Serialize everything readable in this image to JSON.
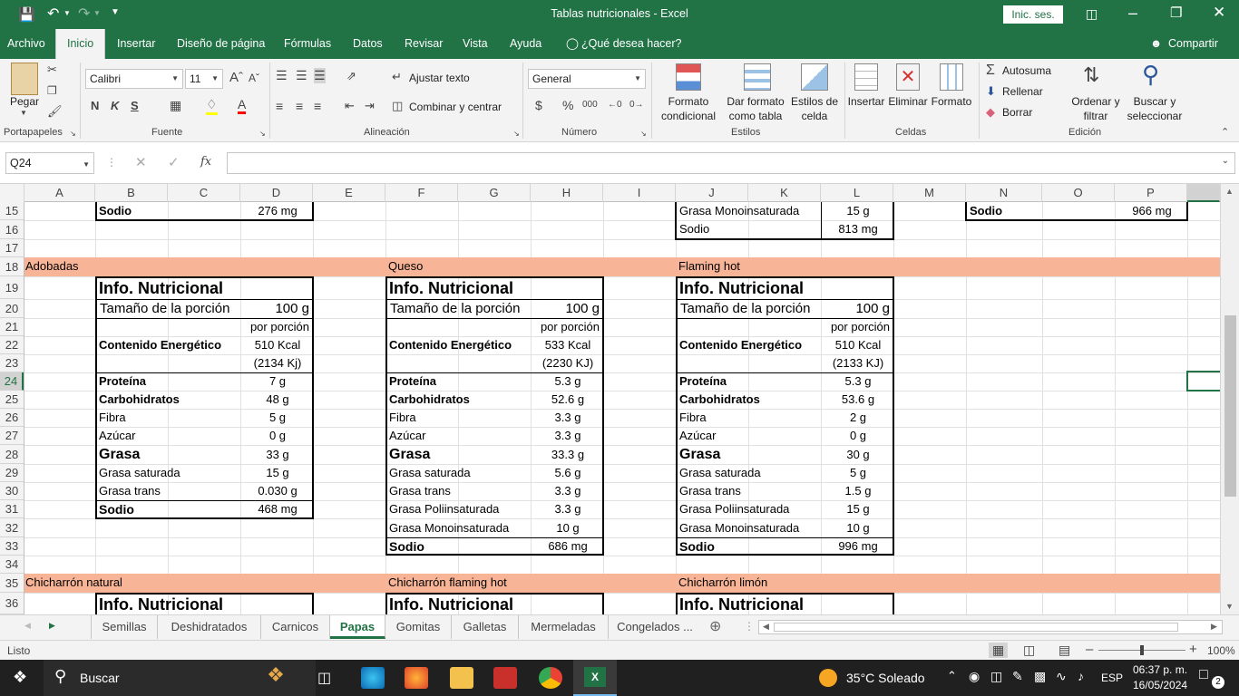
{
  "app": {
    "title": "Tablas nutricionales  -  Excel",
    "signin": "Inic. ses.",
    "share": "Compartir"
  },
  "ribbon_tabs": [
    "Archivo",
    "Inicio",
    "Insertar",
    "Diseño de página",
    "Fórmulas",
    "Datos",
    "Revisar",
    "Vista",
    "Ayuda",
    "¿Qué desea hacer?"
  ],
  "ribbon": {
    "paste": "Pegar",
    "font_name": "Calibri",
    "font_size": "11",
    "wrap_text": "Ajustar texto",
    "merge_center": "Combinar y centrar",
    "number_format": "General",
    "cond_format_1": "Formato",
    "cond_format_2": "condicional",
    "format_table_1": "Dar formato",
    "format_table_2": "como tabla",
    "cell_styles_1": "Estilos de",
    "cell_styles_2": "celda",
    "insert": "Insertar",
    "delete": "Eliminar",
    "format": "Formato",
    "autosum": "Autosuma",
    "fill": "Rellenar",
    "clear": "Borrar",
    "sort_1": "Ordenar y",
    "sort_2": "filtrar",
    "find_1": "Buscar y",
    "find_2": "seleccionar",
    "groups": [
      "Portapapeles",
      "Fuente",
      "Alineación",
      "Número",
      "Estilos",
      "Celdas",
      "Edición"
    ]
  },
  "formula_bar": {
    "name_box": "Q24",
    "fx": "fx",
    "content": ""
  },
  "columns": [
    "A",
    "B",
    "C",
    "D",
    "E",
    "F",
    "G",
    "H",
    "I",
    "J",
    "K",
    "L",
    "M",
    "N",
    "O",
    "P"
  ],
  "rows": [
    "15",
    "16",
    "17",
    "18",
    "19",
    "20",
    "21",
    "22",
    "23",
    "24",
    "25",
    "26",
    "27",
    "28",
    "29",
    "30",
    "31",
    "32",
    "33",
    "34",
    "35",
    "36"
  ],
  "top_cells": {
    "b15": "Sodio",
    "d15": "276 mg",
    "j15": "Grasa Monoinsaturada",
    "l15": "15 g",
    "j16": "Sodio",
    "l16": "813 mg",
    "n15": "Sodio",
    "p15": "966 mg"
  },
  "section_titles": {
    "row18": [
      "Adobadas",
      "Queso",
      "Flaming hot"
    ],
    "row35": [
      "Chicharrón natural",
      "Chicharrón flaming hot",
      "Chicharrón limón"
    ]
  },
  "labels": {
    "info": "Info. Nutricional",
    "portion": "Tamaño de la porción",
    "portion_value": "100 g",
    "per_portion": "por porción",
    "energy": "Contenido Energético",
    "protein": "Proteína",
    "carbs": "Carbohidratos",
    "fiber": "Fibra",
    "sugar": "Azúcar",
    "fat": "Grasa",
    "sat_fat": "Grasa saturada",
    "trans_fat": "Grasa trans",
    "poly_fat": "Grasa Poliinsaturada",
    "mono_fat": "Grasa Monoinsaturada",
    "sodium": "Sodio"
  },
  "tables": {
    "adobadas": {
      "kcal": "510 Kcal",
      "kj": "(2134 Kj)",
      "protein": "7 g",
      "carbs": "48 g",
      "fiber": "5 g",
      "sugar": "0 g",
      "fat": "33 g",
      "sat_fat": "15 g",
      "trans_fat": "0.030 g",
      "sodium": "468 mg"
    },
    "queso": {
      "kcal": "533 Kcal",
      "kj": "(2230 KJ)",
      "protein": "5.3 g",
      "carbs": "52.6 g",
      "fiber": "3.3 g",
      "sugar": "3.3 g",
      "fat": "33.3 g",
      "sat_fat": "5.6 g",
      "trans_fat": "3.3 g",
      "poly_fat": "3.3 g",
      "mono_fat": "10 g",
      "sodium": "686 mg"
    },
    "flaming": {
      "kcal": "510 Kcal",
      "kj": "(2133 KJ)",
      "protein": "5.3 g",
      "carbs": "53.6 g",
      "fiber": "2 g",
      "sugar": "0 g",
      "fat": "30 g",
      "sat_fat": "5 g",
      "trans_fat": "1.5 g",
      "poly_fat": "15 g",
      "mono_fat": "10 g",
      "sodium": "996 mg"
    }
  },
  "sheet_tabs": [
    "Semillas",
    "Deshidratados",
    "Carnicos",
    "Papas",
    "Gomitas",
    "Galletas",
    "Mermeladas",
    "Congelados ..."
  ],
  "status": {
    "ready": "Listo",
    "zoom": "100%"
  },
  "taskbar": {
    "search": "Buscar",
    "weather": "35°C  Soleado",
    "lang": "ESP",
    "time": "06:37 p. m.",
    "date": "16/05/2024",
    "notif": "2"
  },
  "colors": {
    "excel_green": "#217346",
    "band": "#f8b497"
  }
}
